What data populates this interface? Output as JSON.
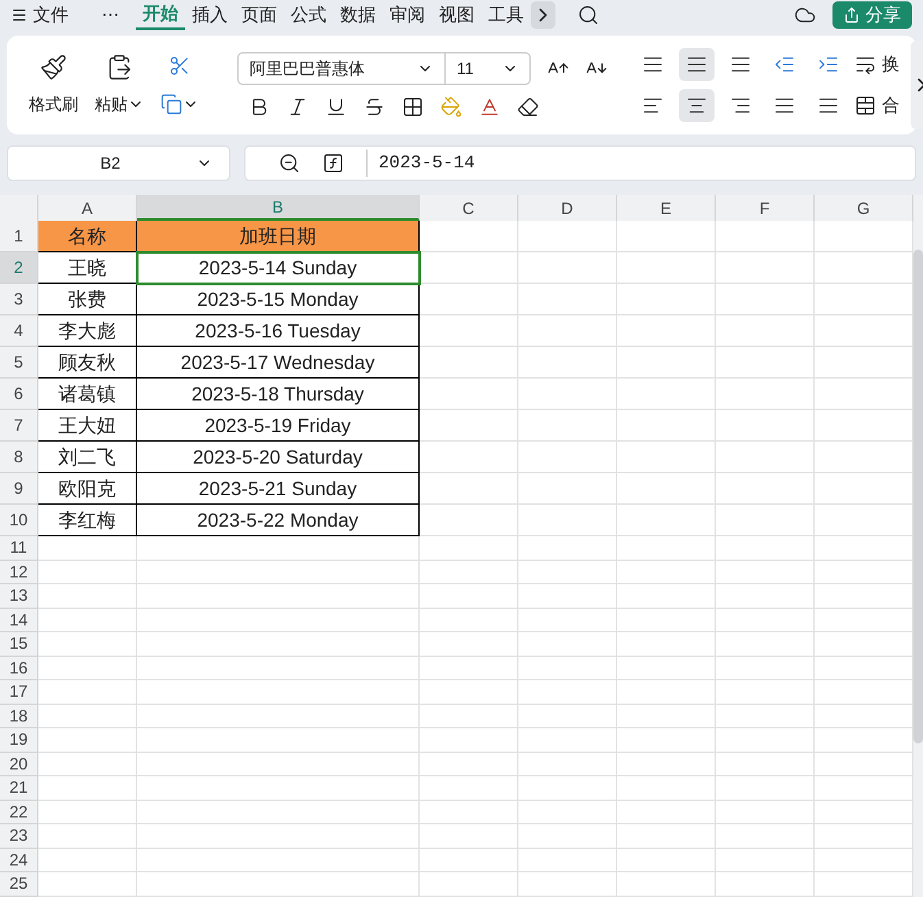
{
  "menu_tabs": [
    {
      "label": "文件",
      "selected": false,
      "kind": "file"
    },
    {
      "label": "⋯",
      "selected": false,
      "kind": "more"
    },
    {
      "label": "开始",
      "selected": true,
      "kind": "tab"
    },
    {
      "label": "插入",
      "selected": false,
      "kind": "tab"
    },
    {
      "label": "页面",
      "selected": false,
      "kind": "tab"
    },
    {
      "label": "公式",
      "selected": false,
      "kind": "tab"
    },
    {
      "label": "数据",
      "selected": false,
      "kind": "tab"
    },
    {
      "label": "审阅",
      "selected": false,
      "kind": "tab"
    },
    {
      "label": "视图",
      "selected": false,
      "kind": "tab"
    },
    {
      "label": "工具",
      "selected": false,
      "kind": "tab"
    }
  ],
  "share_button": {
    "label": "分享"
  },
  "ribbon": {
    "format_painter": "格式刷",
    "paste": "粘贴",
    "font": {
      "value": "阿里巴巴普惠体"
    },
    "size": {
      "value": "11"
    },
    "align_top": [
      {
        "kind": "top",
        "selected": false
      },
      {
        "kind": "middle",
        "selected": true
      },
      {
        "kind": "bottom",
        "selected": false
      },
      {
        "kind": "outdent",
        "selected": false
      },
      {
        "kind": "indent",
        "selected": false
      }
    ],
    "align_bottom": [
      {
        "kind": "left",
        "selected": false
      },
      {
        "kind": "center",
        "selected": true
      },
      {
        "kind": "right",
        "selected": false
      },
      {
        "kind": "justify",
        "selected": false
      },
      {
        "kind": "distributed",
        "selected": false
      }
    ],
    "wrap": "换",
    "merge": "合"
  },
  "name_box": {
    "value": "B2"
  },
  "formula": {
    "value": "2023-5-14"
  },
  "columns": [
    {
      "label": "A",
      "selected": false
    },
    {
      "label": "B",
      "selected": true
    },
    {
      "label": "C",
      "selected": false
    },
    {
      "label": "D",
      "selected": false
    },
    {
      "label": "E",
      "selected": false
    },
    {
      "label": "F",
      "selected": false
    },
    {
      "label": "G",
      "selected": false
    }
  ],
  "rows": [
    {
      "number": "1",
      "selected": false,
      "cells": [
        "名称",
        "加班日期"
      ],
      "kind": "header"
    },
    {
      "number": "2",
      "selected": true,
      "cells": [
        "王晓",
        "2023-5-14 Sunday"
      ],
      "kind": "data"
    },
    {
      "number": "3",
      "selected": false,
      "cells": [
        "张费",
        "2023-5-15 Monday"
      ],
      "kind": "data"
    },
    {
      "number": "4",
      "selected": false,
      "cells": [
        "李大彪",
        "2023-5-16 Tuesday"
      ],
      "kind": "data"
    },
    {
      "number": "5",
      "selected": false,
      "cells": [
        "顾友秋",
        "2023-5-17 Wednesday"
      ],
      "kind": "data"
    },
    {
      "number": "6",
      "selected": false,
      "cells": [
        "诸葛镇",
        "2023-5-18 Thursday"
      ],
      "kind": "data"
    },
    {
      "number": "7",
      "selected": false,
      "cells": [
        "王大妞",
        "2023-5-19 Friday"
      ],
      "kind": "data"
    },
    {
      "number": "8",
      "selected": false,
      "cells": [
        "刘二飞",
        "2023-5-20 Saturday"
      ],
      "kind": "data"
    },
    {
      "number": "9",
      "selected": false,
      "cells": [
        "欧阳克",
        "2023-5-21 Sunday"
      ],
      "kind": "data"
    },
    {
      "number": "10",
      "selected": false,
      "cells": [
        "李红梅",
        "2023-5-22 Monday"
      ],
      "kind": "data"
    },
    {
      "number": "11",
      "selected": false,
      "cells": [],
      "kind": "empty"
    },
    {
      "number": "12",
      "selected": false,
      "cells": [],
      "kind": "empty"
    },
    {
      "number": "13",
      "selected": false,
      "cells": [],
      "kind": "empty"
    },
    {
      "number": "14",
      "selected": false,
      "cells": [],
      "kind": "empty"
    },
    {
      "number": "15",
      "selected": false,
      "cells": [],
      "kind": "empty"
    },
    {
      "number": "16",
      "selected": false,
      "cells": [],
      "kind": "empty"
    },
    {
      "number": "17",
      "selected": false,
      "cells": [],
      "kind": "empty"
    },
    {
      "number": "18",
      "selected": false,
      "cells": [],
      "kind": "empty"
    },
    {
      "number": "19",
      "selected": false,
      "cells": [],
      "kind": "empty"
    },
    {
      "number": "20",
      "selected": false,
      "cells": [],
      "kind": "empty"
    },
    {
      "number": "21",
      "selected": false,
      "cells": [],
      "kind": "empty"
    },
    {
      "number": "22",
      "selected": false,
      "cells": [],
      "kind": "empty"
    },
    {
      "number": "23",
      "selected": false,
      "cells": [],
      "kind": "empty"
    },
    {
      "number": "24",
      "selected": false,
      "cells": [],
      "kind": "empty"
    },
    {
      "number": "25",
      "selected": false,
      "cells": [],
      "kind": "empty"
    }
  ]
}
